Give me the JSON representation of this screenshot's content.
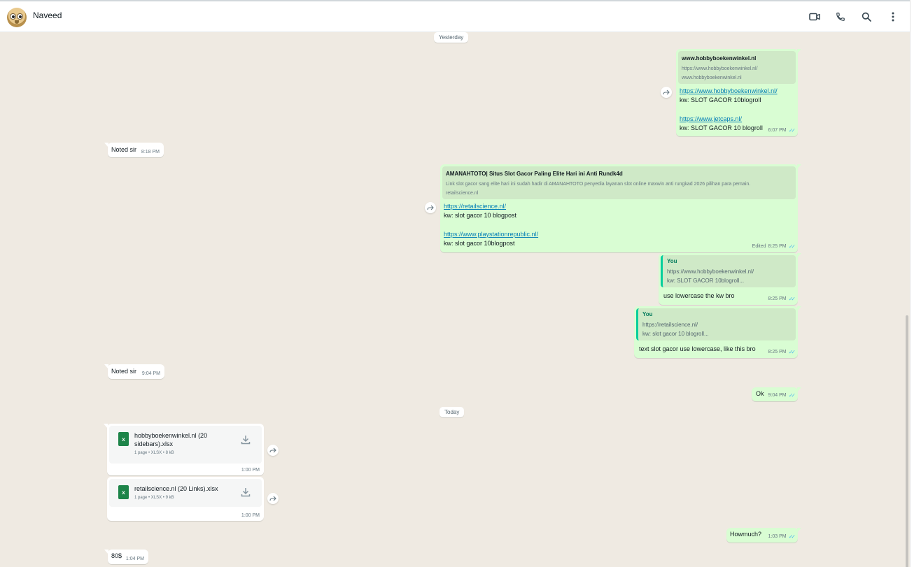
{
  "header": {
    "contact_name": "Naveed",
    "icons": [
      "video-call-icon",
      "voice-call-icon",
      "search-icon",
      "menu-icon"
    ]
  },
  "dates": {
    "yesterday": "Yesterday",
    "today": "Today"
  },
  "messages": {
    "m1": {
      "preview_title": "www.hobbyboekenwinkel.nl",
      "preview_desc1": "https://www.hobbyboekenwinkel.nl/",
      "preview_desc2": "www.hobbyboekenwinkel.nl",
      "link1": "https://www.hobbyboekenwinkel.nl/",
      "kw1": "kw: SLOT GACOR 10blogroll",
      "link2": "https://www.jetcaps.nl/",
      "kw2": "kw: SLOT GACOR 10 blogroll",
      "time": "6:07 PM"
    },
    "m2": {
      "text": "Noted sir",
      "time": "8:18 PM"
    },
    "m3": {
      "preview_title": "AMANAHTOTO| Situs Slot Gacor Paling Elite Hari ini Anti Rundk4d",
      "preview_desc1": "Link slot gacor sang elite hari ini sudah hadir di AMANAHTOTO penyedia layanan slot online maxwin anti rungkad 2026 pilihan para pemain.",
      "preview_desc2": "retailscience.nl",
      "link1": "https://retailscience.nl/",
      "kw1": "kw: slot gacor 10 blogpost",
      "link2": "https://www.playstationrepublic.nl/",
      "kw2": "kw: slot gacor 10blogpost",
      "edited": "Edited",
      "time": "8:25 PM"
    },
    "m4": {
      "quote_author": "You",
      "quote_line1": "https://www.hobbyboekenwinkel.nl/",
      "quote_line2": "kw: SLOT GACOR 10blogroll...",
      "text": "use lowercase the kw bro",
      "time": "8:25 PM"
    },
    "m5": {
      "quote_author": "You",
      "quote_line1": "https://retailscience.nl/",
      "quote_line2": "kw: slot gacor 10 blogroll...",
      "text": "text slot gacor use lowercase, like this bro",
      "time": "8:25 PM"
    },
    "m6": {
      "text": "Noted sir",
      "time": "9:04 PM"
    },
    "m7": {
      "text": "Ok",
      "time": "9:04 PM"
    },
    "m8": {
      "file_icon": "x",
      "file_name": "hobbyboekenwinkel.nl (20 sidebars).xlsx",
      "file_info": "1 page • XLSX • 8 kB",
      "time": "1:00 PM"
    },
    "m9": {
      "file_icon": "x",
      "file_name": "retailscience.nl (20 Links).xlsx",
      "file_info": "1 page • XLSX • 9 kB",
      "time": "1:00 PM"
    },
    "m10": {
      "text": "Howmuch?",
      "time": "1:03 PM"
    },
    "m11": {
      "text": "80$",
      "time": "1:04 PM"
    }
  },
  "colors": {
    "chat_bg": "#efeae2",
    "outgoing_bubble": "#d9fdd3",
    "incoming_bubble": "#ffffff",
    "read_ticks": "#53bdeb",
    "link": "#027eb5",
    "excel_green": "#1d8449"
  }
}
